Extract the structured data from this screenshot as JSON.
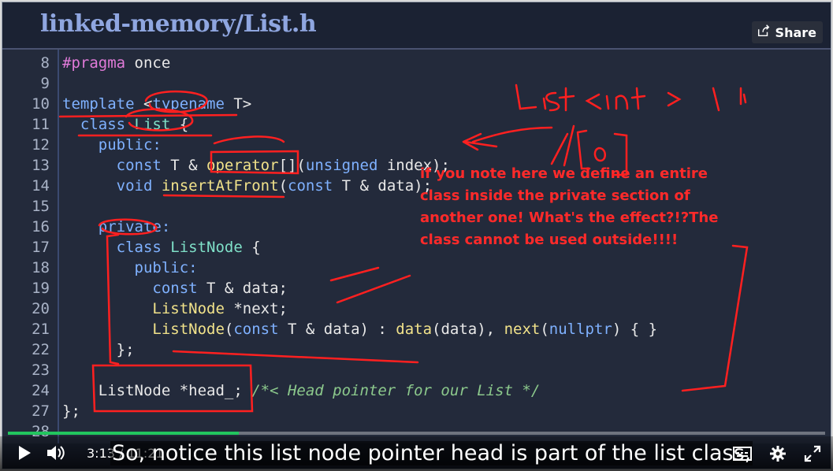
{
  "header": {
    "title": "linked-memory/List.h",
    "share_label": "Share"
  },
  "code_lines": [
    {
      "num": "8",
      "parts": [
        [
          "#pragma ",
          "pp"
        ],
        [
          "once",
          ""
        ]
      ]
    },
    {
      "num": "9",
      "parts": []
    },
    {
      "num": "10",
      "parts": [
        [
          "template ",
          "kw"
        ],
        [
          "<",
          ""
        ],
        [
          "typename ",
          "kw"
        ],
        [
          "T>",
          ""
        ]
      ]
    },
    {
      "num": "11",
      "parts": [
        [
          "  class ",
          "kw"
        ],
        [
          "List ",
          "ty"
        ],
        [
          "{",
          ""
        ]
      ]
    },
    {
      "num": "12",
      "parts": [
        [
          "    public:",
          "kw"
        ]
      ]
    },
    {
      "num": "13",
      "parts": [
        [
          "      const ",
          "kw"
        ],
        [
          "T & ",
          ""
        ],
        [
          "operator",
          "fn"
        ],
        [
          "[](",
          ""
        ],
        [
          "unsigned ",
          "kw"
        ],
        [
          "index);",
          ""
        ]
      ]
    },
    {
      "num": "14",
      "parts": [
        [
          "      void ",
          "kw"
        ],
        [
          "insertAtFront",
          "fn"
        ],
        [
          "(",
          ""
        ],
        [
          "const ",
          "kw"
        ],
        [
          "T & data);",
          ""
        ]
      ]
    },
    {
      "num": "15",
      "parts": []
    },
    {
      "num": "16",
      "parts": [
        [
          "    private:",
          "kw"
        ]
      ]
    },
    {
      "num": "17",
      "parts": [
        [
          "      class ",
          "kw"
        ],
        [
          "ListNode ",
          "ty"
        ],
        [
          "{",
          ""
        ]
      ]
    },
    {
      "num": "18",
      "parts": [
        [
          "        public:",
          "kw"
        ]
      ]
    },
    {
      "num": "19",
      "parts": [
        [
          "          const ",
          "kw"
        ],
        [
          "T & data;",
          ""
        ]
      ]
    },
    {
      "num": "20",
      "parts": [
        [
          "          ListNode ",
          "fn"
        ],
        [
          "*next;",
          ""
        ]
      ]
    },
    {
      "num": "21",
      "parts": [
        [
          "          ListNode",
          "fn"
        ],
        [
          "(",
          ""
        ],
        [
          "const ",
          "kw"
        ],
        [
          "T & data) : ",
          ""
        ],
        [
          "data",
          "fn"
        ],
        [
          "(data), ",
          ""
        ],
        [
          "next",
          "fn"
        ],
        [
          "(",
          ""
        ],
        [
          "nullptr",
          "kw"
        ],
        [
          ") { }",
          ""
        ]
      ]
    },
    {
      "num": "22",
      "parts": [
        [
          "      };",
          ""
        ]
      ]
    },
    {
      "num": "23",
      "parts": []
    },
    {
      "num": "24",
      "parts": [
        [
          "    ListNode *head_; ",
          ""
        ],
        [
          "/*< Head pointer for our List */",
          "cm"
        ]
      ]
    },
    {
      "num": "27",
      "parts": [
        [
          "};",
          ""
        ]
      ]
    },
    {
      "num": "28",
      "parts": []
    }
  ],
  "annotation": {
    "note": "if you note here we define an entire class inside the private section of another one! What's the effect?!?The class cannot be used outside!!!!"
  },
  "player": {
    "current_time": "3:13",
    "duration": "11:21",
    "time_text": "3:13 / 11:21",
    "progress": 0.283,
    "subtitle": "So, notice this list node pointer head is part of the list class,",
    "accent_color": "#22c55e"
  },
  "icons": [
    "share-icon",
    "play-icon",
    "volume-icon",
    "captions-icon",
    "gear-icon",
    "fullscreen-icon"
  ]
}
